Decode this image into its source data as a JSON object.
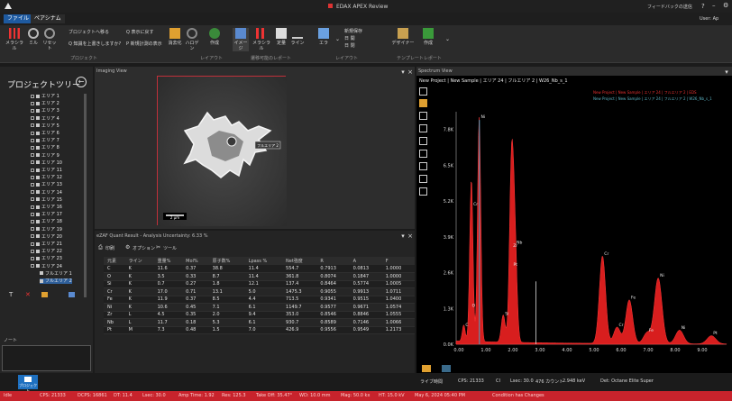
{
  "window": {
    "title": "EDAX APEX Review"
  },
  "titlebar_right": {
    "feedback": "フィードバックの送信",
    "user": "User: Ap"
  },
  "menu": {
    "file": "ファイル",
    "tab_active": "ペアシナム"
  },
  "ribbon": {
    "buttons": [
      {
        "label": "メラシラル",
        "icon": "bar-chart-icon"
      },
      {
        "label": "ミル",
        "icon": "mill-icon"
      },
      {
        "label": "リセット",
        "icon": "reset-icon"
      },
      {
        "label": "ブロジェクトへ移る",
        "icon": "project-icon"
      },
      {
        "label": "Q 知識を上書きしますか?",
        "icon": "question-icon"
      },
      {
        "label": "Q 表示に戻す",
        "icon": "view-icon"
      },
      {
        "label": "P 新規計測の表示",
        "icon": "new-measure-icon"
      },
      {
        "label": "消去化",
        "icon": "clear-icon"
      },
      {
        "label": "ハロゲン",
        "icon": "halogen-icon"
      },
      {
        "label": "作成",
        "icon": "create-icon"
      },
      {
        "label": "イメージ",
        "icon": "image-icon"
      },
      {
        "label": "メラシラル",
        "icon": "spectrum-icon"
      },
      {
        "label": "定量",
        "icon": "quant-icon"
      },
      {
        "label": "ライン",
        "icon": "line-icon"
      },
      {
        "label": "エラ",
        "icon": "map-icon"
      },
      {
        "label": "新規保存",
        "icon": "save-icon"
      },
      {
        "label": "日 開",
        "icon": "open-icon"
      },
      {
        "label": "日 閉",
        "icon": "close-doc-icon"
      },
      {
        "label": "デザイナー",
        "icon": "designer-icon"
      },
      {
        "label": "作成",
        "icon": "create2-icon"
      }
    ],
    "groups": [
      "プロジェクト",
      "レイアウト",
      "遷移可能のレポート",
      "レイアウト",
      "テンプレートレポート"
    ]
  },
  "tree": {
    "title": "プロジェクトツリー",
    "items": [
      "エリア 1",
      "エリア 2",
      "エリア 3",
      "エリア 4",
      "エリア 5",
      "エリア 6",
      "エリア 7",
      "エリア 8",
      "エリア 9",
      "エリア 10",
      "エリア 11",
      "エリア 12",
      "エリア 13",
      "エリア 14",
      "エリア 15",
      "エリア 16",
      "エリア 17",
      "エリア 18",
      "エリア 19",
      "エリア 20",
      "エリア 21",
      "エリア 22",
      "エリア 23",
      "エリア 24"
    ],
    "sub_items": [
      "フルエリア 1",
      "フルエリア 2"
    ],
    "notes_label": "ノート"
  },
  "imaging": {
    "title": "Imaging View",
    "scale": "2 µm",
    "area_label": "フルエリア 2"
  },
  "quant": {
    "title": "eZAF Quant Result - Analysis Uncertainty: 6.33 %",
    "toolbar": {
      "print": "印刷",
      "options": "オプション",
      "tools": "ツール"
    },
    "headers": [
      "元素",
      "ライン",
      "重量%",
      "Mol%",
      "原子数%",
      "Lpass %",
      "Net強度",
      "R",
      "A",
      "F"
    ],
    "rows": [
      [
        "C",
        "K",
        "11.6",
        "0.37",
        "38.8",
        "11.4",
        "554.7",
        "0.7913",
        "0.0813",
        "1.0000"
      ],
      [
        "O",
        "K",
        "3.5",
        "0.33",
        "8.7",
        "11.4",
        "361.8",
        "0.8074",
        "0.1847",
        "1.0000"
      ],
      [
        "Si",
        "K",
        "0.7",
        "0.27",
        "1.8",
        "12.1",
        "137.4",
        "0.8464",
        "0.5774",
        "1.0005"
      ],
      [
        "Cr",
        "K",
        "17.0",
        "0.71",
        "13.1",
        "5.0",
        "1475.3",
        "0.9055",
        "0.9913",
        "1.0711"
      ],
      [
        "Fe",
        "K",
        "11.9",
        "0.37",
        "8.5",
        "4.4",
        "713.5",
        "0.9341",
        "0.9515",
        "1.0400"
      ],
      [
        "Ni",
        "K",
        "10.6",
        "0.45",
        "7.1",
        "6.1",
        "1149.7",
        "0.9577",
        "0.9671",
        "1.0574"
      ],
      [
        "Zr",
        "L",
        "4.5",
        "0.35",
        "2.0",
        "9.4",
        "353.0",
        "0.8546",
        "0.8846",
        "1.0555"
      ],
      [
        "Nb",
        "L",
        "11.7",
        "0.18",
        "5.3",
        "6.1",
        "930.7",
        "0.8589",
        "0.7146",
        "1.0066"
      ],
      [
        "Pt",
        "M",
        "7.3",
        "0.48",
        "1.5",
        "7.0",
        "426.9",
        "0.9556",
        "0.9549",
        "1.2173"
      ]
    ]
  },
  "spectrum": {
    "title": "Spectrum View",
    "subtitle": "New Project | New Sample | エリア 24 | フルエリア 2 | W26_Nb_s_1",
    "legend": [
      "New Project | New Sample | エリア 24 | フルエリア 2 | EDS",
      "New Project | New Sample | エリア 24 | フルエリア 2 | W26_Nb_s_1"
    ],
    "footer": {
      "label": "ライブ時間",
      "cps": "CPS: 21333",
      "cps2": "CI",
      "lsec": "Lsec: 30.0",
      "count": "476 カウント",
      "kev": "2.948 keV",
      "det": "Det: Octane Elite Super"
    }
  },
  "chart_data": {
    "type": "line",
    "title": "",
    "xlabel": "",
    "ylabel": "",
    "xlim": [
      0,
      10
    ],
    "ylim": [
      0,
      8.5
    ],
    "y_ticks": [
      "7.8K",
      "6.5K",
      "5.2K",
      "3.9K",
      "2.6K",
      "1.3K",
      "0.0K"
    ],
    "x_ticks": [
      "0.00",
      "1.00",
      "2.00",
      "3.00",
      "4.00",
      "5.00",
      "6.00",
      "7.00",
      "8.00",
      "9.00"
    ],
    "peaks": [
      {
        "label": "C",
        "x": 0.28,
        "y": 0.6
      },
      {
        "label": "O",
        "x": 0.52,
        "y": 1.3
      },
      {
        "label": "Ni",
        "x": 0.85,
        "y": 8.2
      },
      {
        "label": "Cr",
        "x": 0.57,
        "y": 5.0
      },
      {
        "label": "Si",
        "x": 1.74,
        "y": 1.0
      },
      {
        "label": "Zr",
        "x": 2.04,
        "y": 3.5
      },
      {
        "label": "Nb",
        "x": 2.17,
        "y": 3.6
      },
      {
        "label": "Pt",
        "x": 2.05,
        "y": 2.8
      },
      {
        "label": "Cr",
        "x": 5.41,
        "y": 3.2
      },
      {
        "label": "Fe",
        "x": 6.4,
        "y": 1.6
      },
      {
        "label": "Cr",
        "x": 5.95,
        "y": 0.6
      },
      {
        "label": "Fe",
        "x": 7.06,
        "y": 0.4
      },
      {
        "label": "Ni",
        "x": 7.47,
        "y": 2.4
      },
      {
        "label": "Ni",
        "x": 8.26,
        "y": 0.5
      },
      {
        "label": "Pt",
        "x": 9.44,
        "y": 0.3
      }
    ]
  },
  "status": {
    "items": [
      "Idle",
      "CPS: 21333",
      "DCPS: 16861",
      "DT: 11.4",
      "Lsec: 30.0",
      "Amp Time: 1.92",
      "Res: 125.3",
      "Take Off: 35.47°",
      "WD: 10.0 mm",
      "Mag: 50.0 kx",
      "HT: 15.0 kV",
      "May 6, 2024 05:40 PM",
      "Condition has Changes"
    ]
  }
}
